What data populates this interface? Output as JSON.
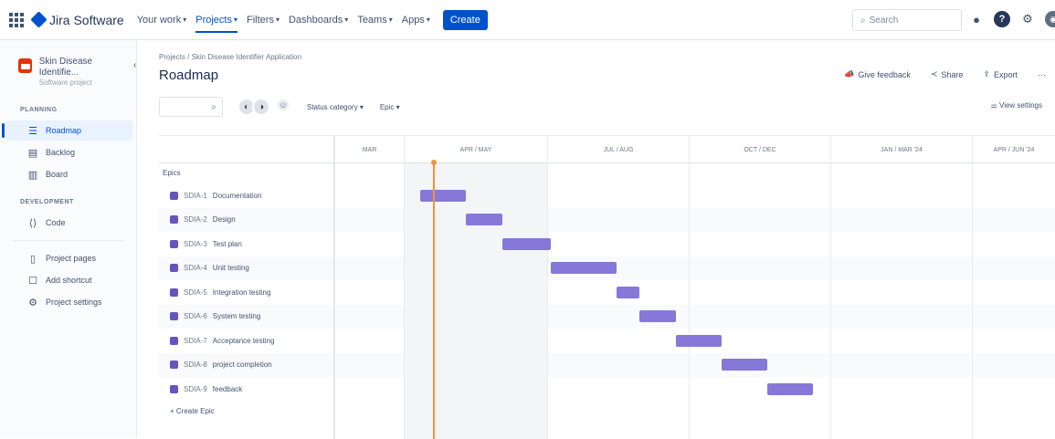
{
  "topbar": {
    "product": "Jira Software",
    "nav": [
      {
        "label": "Your work",
        "active": false
      },
      {
        "label": "Projects",
        "active": true
      },
      {
        "label": "Filters",
        "active": false
      },
      {
        "label": "Dashboards",
        "active": false
      },
      {
        "label": "Teams",
        "active": false
      },
      {
        "label": "Apps",
        "active": false
      }
    ],
    "create_label": "Create",
    "search_placeholder": "Search"
  },
  "sidebar": {
    "project_name": "Skin Disease Identifie...",
    "project_type": "Software project",
    "planning_label": "PLANNING",
    "development_label": "DEVELOPMENT",
    "items": [
      {
        "label": "Roadmap",
        "icon": "roadmap-icon"
      },
      {
        "label": "Backlog",
        "icon": "backlog-icon"
      },
      {
        "label": "Board",
        "icon": "board-icon"
      },
      {
        "label": "Code",
        "icon": "code-icon"
      },
      {
        "label": "Project pages",
        "icon": "pages-icon"
      },
      {
        "label": "Add shortcut",
        "icon": "shortcut-icon"
      },
      {
        "label": "Project settings",
        "icon": "settings-icon"
      }
    ]
  },
  "main": {
    "breadcrumb": "Projects / Skin Disease Identifier Application",
    "title": "Roadmap",
    "actions": {
      "feedback": "Give feedback",
      "share": "Share",
      "export": "Export"
    },
    "filters": {
      "status": "Status category",
      "epic": "Epic"
    },
    "view_settings": "View settings"
  },
  "timeline": {
    "months": [
      "MAR",
      "APR / MAY",
      "JUL / AUG",
      "OCT / DEC",
      "JAN / MAR '24",
      "APR / JUN '24"
    ],
    "epics_label": "Epics",
    "create_epic": "+ Create Epic",
    "epics": [
      {
        "key": "SDIA-1",
        "name": "Documentation",
        "start": 0.0,
        "end": 1.0
      },
      {
        "key": "SDIA-2",
        "name": "Design",
        "start": 1.0,
        "end": 1.8
      },
      {
        "key": "SDIA-3",
        "name": "Test plan",
        "start": 1.8,
        "end": 2.85
      },
      {
        "key": "SDIA-4",
        "name": "Unit testing",
        "start": 2.85,
        "end": 4.3
      },
      {
        "key": "SDIA-5",
        "name": "Integration testing",
        "start": 4.3,
        "end": 4.8
      },
      {
        "key": "SDIA-6",
        "name": "System testing",
        "start": 4.8,
        "end": 5.6
      },
      {
        "key": "SDIA-7",
        "name": "Acceptance testing",
        "start": 5.6,
        "end": 6.6
      },
      {
        "key": "SDIA-8",
        "name": "project completion",
        "start": 6.6,
        "end": 7.6
      },
      {
        "key": "SDIA-9",
        "name": "feedback",
        "start": 7.6,
        "end": 8.6
      }
    ]
  },
  "colors": {
    "accent": "#0052cc",
    "epic_bar": "#8777d9",
    "today": "#f79233"
  }
}
